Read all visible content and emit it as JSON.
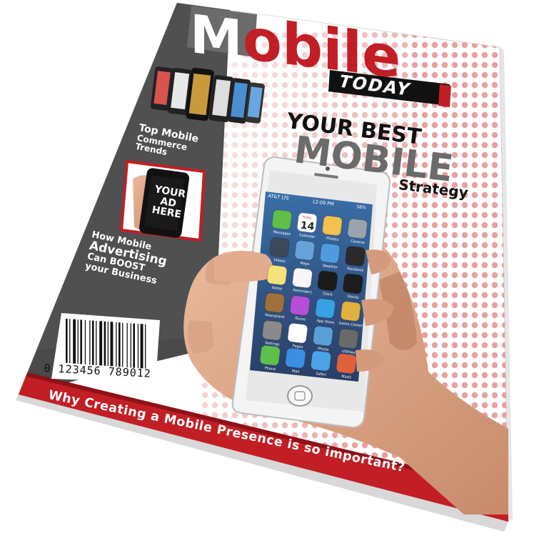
{
  "masthead": {
    "title": "Mobile",
    "subtitle": "TODAY"
  },
  "side_panel": {
    "feature_1": {
      "lines": [
        "Top Mobile",
        "Commerce",
        "Trends"
      ]
    },
    "ad_phone_text": {
      "lines": [
        "YOUR",
        "AD",
        "HERE"
      ]
    },
    "feature_2": {
      "lines": [
        "How Mobile",
        "Advertising",
        "Can BOOST",
        "your Business"
      ]
    }
  },
  "barcode": {
    "digits": "0  123456  789012"
  },
  "headline": {
    "line1": "YOUR BEST",
    "line2": "MOBILE",
    "line3": "Strategy"
  },
  "phone": {
    "carrier": "AT&T  LTE",
    "time": "12:09 PM",
    "battery": "58%",
    "apps": [
      "Messages",
      "Calendar",
      "Photos",
      "Camera",
      "Videos",
      "Maps",
      "Weather",
      "Passbook",
      "Notes",
      "Reminders",
      "Clock",
      "Stocks",
      "Newsstand",
      "iTunes",
      "App Store",
      "Game Center",
      "Settings",
      "Pages",
      "iPhoto",
      "Utilities"
    ],
    "dock": [
      "Phone",
      "Mail",
      "Safari",
      "Music"
    ],
    "calendar_day": "14",
    "calendar_weekday": "Friday"
  },
  "bottom_banner": {
    "text": "Why Creating a Mobile Presence is so important?"
  },
  "colors": {
    "red": "#c21e25",
    "dark_gray": "#4a4a4a",
    "gray": "#6b6b6b",
    "white": "#ffffff",
    "black": "#111111"
  }
}
